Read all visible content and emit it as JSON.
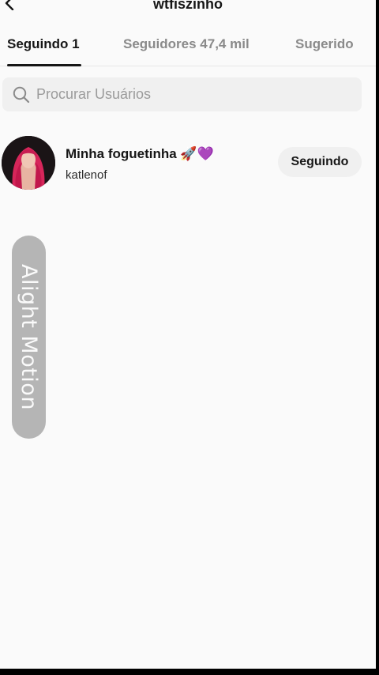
{
  "header": {
    "title": "wtfiszinho",
    "back_icon": "chevron-left-icon"
  },
  "tabs": [
    {
      "label": "Seguindo 1",
      "active": true
    },
    {
      "label": "Seguidores 47,4 mil",
      "active": false
    },
    {
      "label": "Sugerido",
      "active": false
    }
  ],
  "search": {
    "placeholder": "Procurar Usuários",
    "icon": "search-icon"
  },
  "users": [
    {
      "name": "Minha foguetinha 🚀💜",
      "handle": "katlenof",
      "button_label": "Seguindo"
    }
  ],
  "watermark": {
    "text": "Alight Motion"
  },
  "colors": {
    "background": "#fafafa",
    "text_primary": "#161616",
    "text_secondary": "#8a8a8a",
    "button_bg": "#f0f0f0",
    "watermark_bg": "#b5b5b5"
  }
}
